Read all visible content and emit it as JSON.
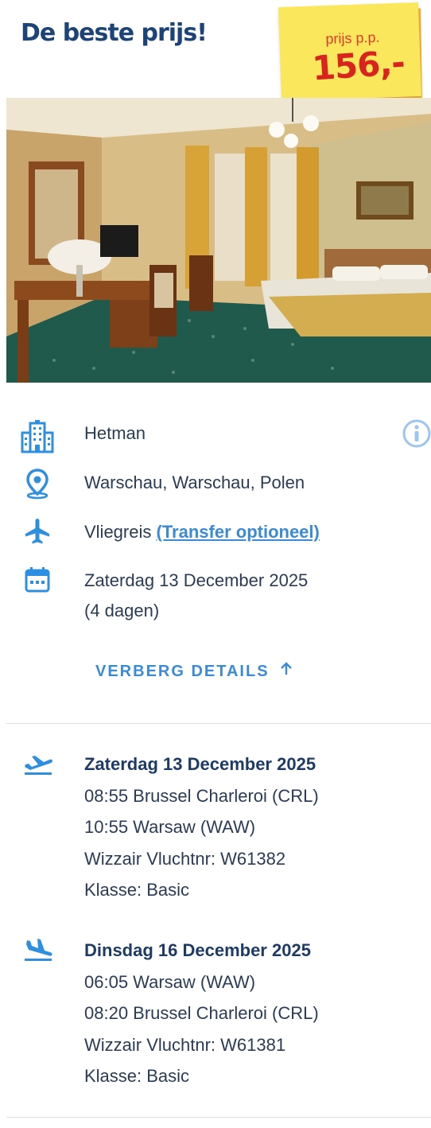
{
  "header": {
    "title": "De beste prijs!",
    "price_label": "prijs p.p.",
    "price_value": "156,-"
  },
  "hotel_image": {
    "alt": "Hotelkamer Hetman"
  },
  "details": {
    "hotel_name": "Hetman",
    "location": "Warschau, Warschau, Polen",
    "travel_type": "Vliegreis",
    "transfer_link": "(Transfer optioneel)",
    "date": "Zaterdag 13 December 2025",
    "duration": "(4 dagen)"
  },
  "toggle": {
    "label": "VERBERG DETAILS"
  },
  "flights": [
    {
      "direction": "outbound",
      "date": "Zaterdag 13 December 2025",
      "departure": "08:55 Brussel Charleroi (CRL)",
      "arrival": "10:55 Warsaw (WAW)",
      "carrier": "Wizzair Vluchtnr: W61382",
      "class": "Klasse: Basic"
    },
    {
      "direction": "return",
      "date": "Dinsdag 16 December 2025",
      "departure": "06:05 Warsaw (WAW)",
      "arrival": "08:20 Brussel Charleroi (CRL)",
      "carrier": "Wizzair Vluchtnr: W61381",
      "class": "Klasse: Basic"
    }
  ],
  "colors": {
    "brand_blue": "#1d4478",
    "icon_blue": "#2e8fe0",
    "link_blue": "#3b8ad6",
    "price_red": "#d9231e",
    "sticker_yellow": "#fbe75c"
  },
  "icons": {
    "hotel": "building-icon",
    "location": "map-pin-icon",
    "flight": "airplane-icon",
    "date": "calendar-icon",
    "info": "info-icon",
    "toggle": "arrow-up-icon",
    "outbound": "plane-departure-icon",
    "return": "plane-arrival-icon"
  }
}
